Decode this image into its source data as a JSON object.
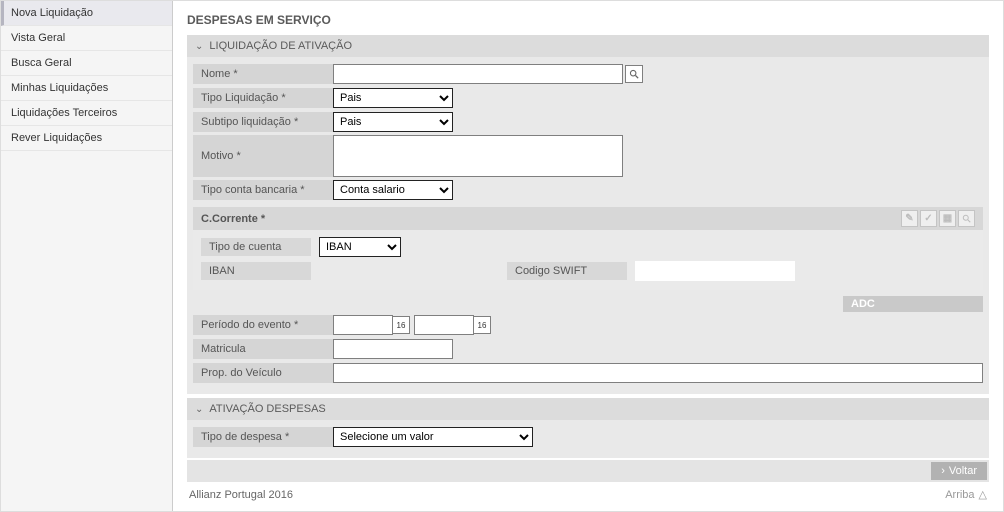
{
  "sidebar": {
    "items": [
      {
        "label": "Nova Liquidação",
        "active": true
      },
      {
        "label": "Vista Geral"
      },
      {
        "label": "Busca Geral"
      },
      {
        "label": "Minhas Liquidações"
      },
      {
        "label": "Liquidações Terceiros"
      },
      {
        "label": "Rever Liquidações"
      }
    ]
  },
  "page": {
    "title": "DESPESAS EM SERVIÇO"
  },
  "sectionA": {
    "title": "LIQUIDAÇÃO DE ATIVAÇÃO",
    "fields": {
      "nome": {
        "label": "Nome *",
        "value": ""
      },
      "tipo_liquidacao": {
        "label": "Tipo Liquidação *",
        "options": [
          "Pais"
        ],
        "selected": "Pais"
      },
      "subtipo_liquidacao": {
        "label": "Subtipo liquidação *",
        "options": [
          "Pais"
        ],
        "selected": "Pais"
      },
      "motivo": {
        "label": "Motivo *",
        "value": ""
      },
      "tipo_conta": {
        "label": "Tipo conta bancaria *",
        "options": [
          "Conta salario"
        ],
        "selected": "Conta salario"
      }
    },
    "subpanel": {
      "title": "C.Corrente *",
      "tipo_cuenta": {
        "label": "Tipo de cuenta",
        "options": [
          "IBAN"
        ],
        "selected": "IBAN"
      },
      "iban": {
        "label": "IBAN",
        "value": ""
      },
      "swift": {
        "label": "Codigo SWIFT",
        "value": ""
      }
    },
    "adc": "ADC",
    "periodo": {
      "label": "Período do evento *",
      "from": "",
      "to": "",
      "cal": "16"
    },
    "matricula": {
      "label": "Matricula",
      "value": ""
    },
    "prop_veiculo": {
      "label": "Prop. do Veículo",
      "value": ""
    }
  },
  "sectionB": {
    "title": "ATIVAÇÃO DESPESAS",
    "tipo_despesa": {
      "label": "Tipo de despesa *",
      "options": [
        "Selecione um valor"
      ],
      "selected": "Selecione um valor"
    }
  },
  "buttons": {
    "voltar": "Voltar"
  },
  "footer": {
    "copyright": "Allianz Portugal 2016",
    "top": "Arriba"
  }
}
